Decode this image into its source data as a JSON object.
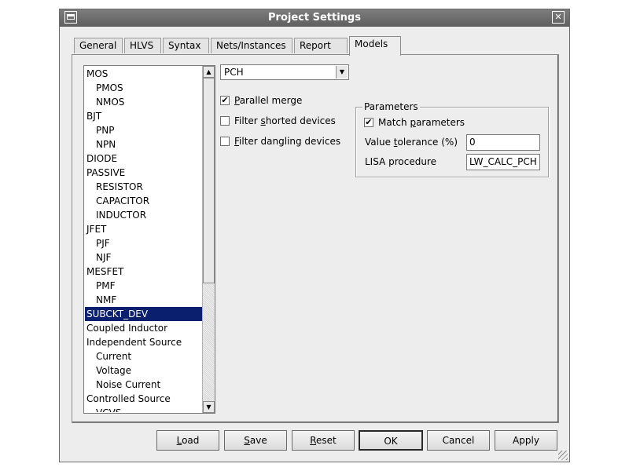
{
  "window": {
    "title": "Project Settings",
    "close_glyph": "✕"
  },
  "tabs": [
    {
      "label": "General"
    },
    {
      "label": "HLVS"
    },
    {
      "label": "Syntax"
    },
    {
      "label": "Nets/Instances"
    },
    {
      "label": "Report"
    },
    {
      "label": "Models",
      "active": true
    }
  ],
  "tree": {
    "items": [
      {
        "label": "MOS",
        "level": 0
      },
      {
        "label": "PMOS",
        "level": 1
      },
      {
        "label": "NMOS",
        "level": 1
      },
      {
        "label": "BJT",
        "level": 0
      },
      {
        "label": "PNP",
        "level": 1
      },
      {
        "label": "NPN",
        "level": 1
      },
      {
        "label": "DIODE",
        "level": 0
      },
      {
        "label": "PASSIVE",
        "level": 0
      },
      {
        "label": "RESISTOR",
        "level": 1
      },
      {
        "label": "CAPACITOR",
        "level": 1
      },
      {
        "label": "INDUCTOR",
        "level": 1
      },
      {
        "label": "JFET",
        "level": 0
      },
      {
        "label": "PJF",
        "level": 1
      },
      {
        "label": "NJF",
        "level": 1
      },
      {
        "label": "MESFET",
        "level": 0
      },
      {
        "label": "PMF",
        "level": 1
      },
      {
        "label": "NMF",
        "level": 1
      },
      {
        "label": "SUBCKT_DEV",
        "level": 0,
        "selected": true
      },
      {
        "label": "Coupled Inductor",
        "level": 0
      },
      {
        "label": "Independent Source",
        "level": 0
      },
      {
        "label": "Current",
        "level": 1
      },
      {
        "label": "Voltage",
        "level": 1
      },
      {
        "label": "Noise Current",
        "level": 1
      },
      {
        "label": "Controlled Source",
        "level": 0
      },
      {
        "label": "VCVS",
        "level": 1
      }
    ],
    "scroll_position": 0.0,
    "visible_fraction": 0.63
  },
  "model_select": {
    "value": "PCH",
    "arrow_glyph": "▼"
  },
  "options": {
    "parallel_merge": {
      "pre": "",
      "key": "P",
      "post": "arallel merge",
      "checked": true
    },
    "filter_shorted": {
      "pre": "Filter ",
      "key": "s",
      "post": "horted devices",
      "checked": false
    },
    "filter_dangling": {
      "pre": "",
      "key": "F",
      "post": "ilter dangling devices",
      "checked": false
    }
  },
  "parameters": {
    "legend": "Parameters",
    "match": {
      "pre": "Match ",
      "key": "p",
      "post": "arameters",
      "checked": true
    },
    "tolerance": {
      "pre": "Value ",
      "key": "t",
      "post": "olerance (%)",
      "value": "0"
    },
    "lisa": {
      "label": "LISA procedure",
      "value": "LW_CALC_PCH"
    }
  },
  "buttons": {
    "load": {
      "pre": "",
      "key": "L",
      "post": "oad"
    },
    "save": {
      "pre": "",
      "key": "S",
      "post": "ave"
    },
    "reset": {
      "pre": "",
      "key": "R",
      "post": "eset"
    },
    "ok": {
      "label": "OK"
    },
    "cancel": {
      "label": "Cancel"
    },
    "apply": {
      "label": "Apply"
    }
  },
  "check_glyph": "✔"
}
